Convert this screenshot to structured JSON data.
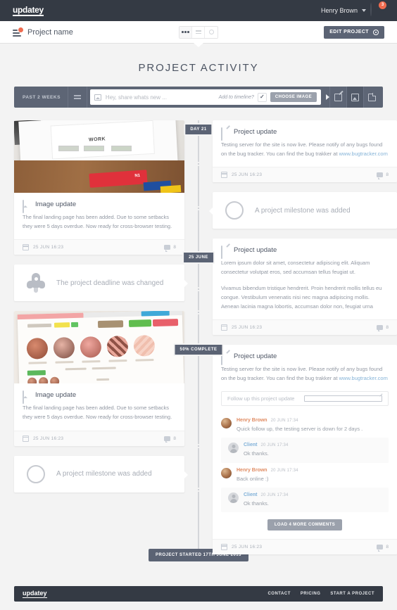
{
  "topnav": {
    "logo": "updatey",
    "user_name": "Henry Brown",
    "notification_count": "3"
  },
  "projectbar": {
    "project_title": "Project name",
    "edit_button": "EDIT PROJECT"
  },
  "page_title": "PROJECT ACTIVITY",
  "composer": {
    "range_label": "PAST 2 WEEKS",
    "placeholder": "Hey, share whats new ...",
    "add_to_timeline_label": "Add to timeline?",
    "choose_image": "CHOOSE IMAGE"
  },
  "markers": {
    "day21": "DAY 21",
    "june25": "25 JUNE",
    "percent50": "50% COMPLETE",
    "project_start": "PROJECT STARTED 17TH JUNE 2013"
  },
  "cards": {
    "image_update_1": {
      "title": "Image update",
      "body": "The final landing page has been added. Due to some setbacks they were 5 days overdue. Now ready for cross-browser testing.",
      "date": "25 JUN 16:23",
      "comments": "8"
    },
    "image_update_2": {
      "title": "Image update",
      "body": "The final landing page has been added. Due to some setbacks they were 5 days overdue. Now ready for cross-browser testing.",
      "date": "25 JUN 16:23",
      "comments": "8"
    },
    "deadline_event": "The project deadline was changed",
    "milestone_event_1": "A project milestone was added",
    "milestone_event_2": "A project milestone was added",
    "update_1": {
      "title": "Project update",
      "body_prefix": "Testing server for the site is now live. Please notify of any bugs found on the bug tracker. You can find the bug trakker at ",
      "link": "www.bugtracker.com",
      "date": "25 JUN 16:23",
      "comments": "8"
    },
    "update_2": {
      "title": "Project update",
      "paragraph_1": "Lorem ipsum dolor sit amet, consectetur adipiscing elit. Aliquam consectetur volutpat eros, sed accumsan tellus feugiat ut.",
      "paragraph_2": "Vivamus bibendum tristique hendrerit. Proin hendrerit mollis tellus eu congue. Vestibulum venenatis nisi nec magna adipiscing mollis. Aenean lacinia magna lobortis, accumsan dolor non, feugiat urna",
      "date": "25 JUN 16:23",
      "comments": "8"
    },
    "update_3": {
      "title": "Project update",
      "body_prefix": "Testing server for the site is now live. Please notify of any bugs found on the bug tracker. You can find the bug trakker at ",
      "link": "www.bugtracker.com",
      "followup_placeholder": "Follow up this project update",
      "load_more": "LOAD 4 MORE COMMENTS",
      "date": "25 JUN 16:23",
      "comments": "8",
      "comments_list": [
        {
          "author": "Henry Brown",
          "date": "20 JUN 17:34",
          "text": "Quick follow up, the testing server is down for 2 days ."
        },
        {
          "author": "Client",
          "date": "20 JUN 17:34",
          "text": "Ok thanks."
        },
        {
          "author": "Henry Brown",
          "date": "20 JUN 17:34",
          "text": "Back online :)"
        },
        {
          "author": "Client",
          "date": "20 JUN 17:34",
          "text": "Ok thanks."
        }
      ]
    }
  },
  "footer": {
    "logo": "updatey",
    "links": [
      "CONTACT",
      "PRICING",
      "START A PROJECT"
    ]
  },
  "colors": {
    "dark": "#343a44",
    "slate": "#5b6374",
    "accent_orange": "#ef6b4f",
    "link_blue": "#86b4d8",
    "page_bg": "#f3f3f3"
  }
}
